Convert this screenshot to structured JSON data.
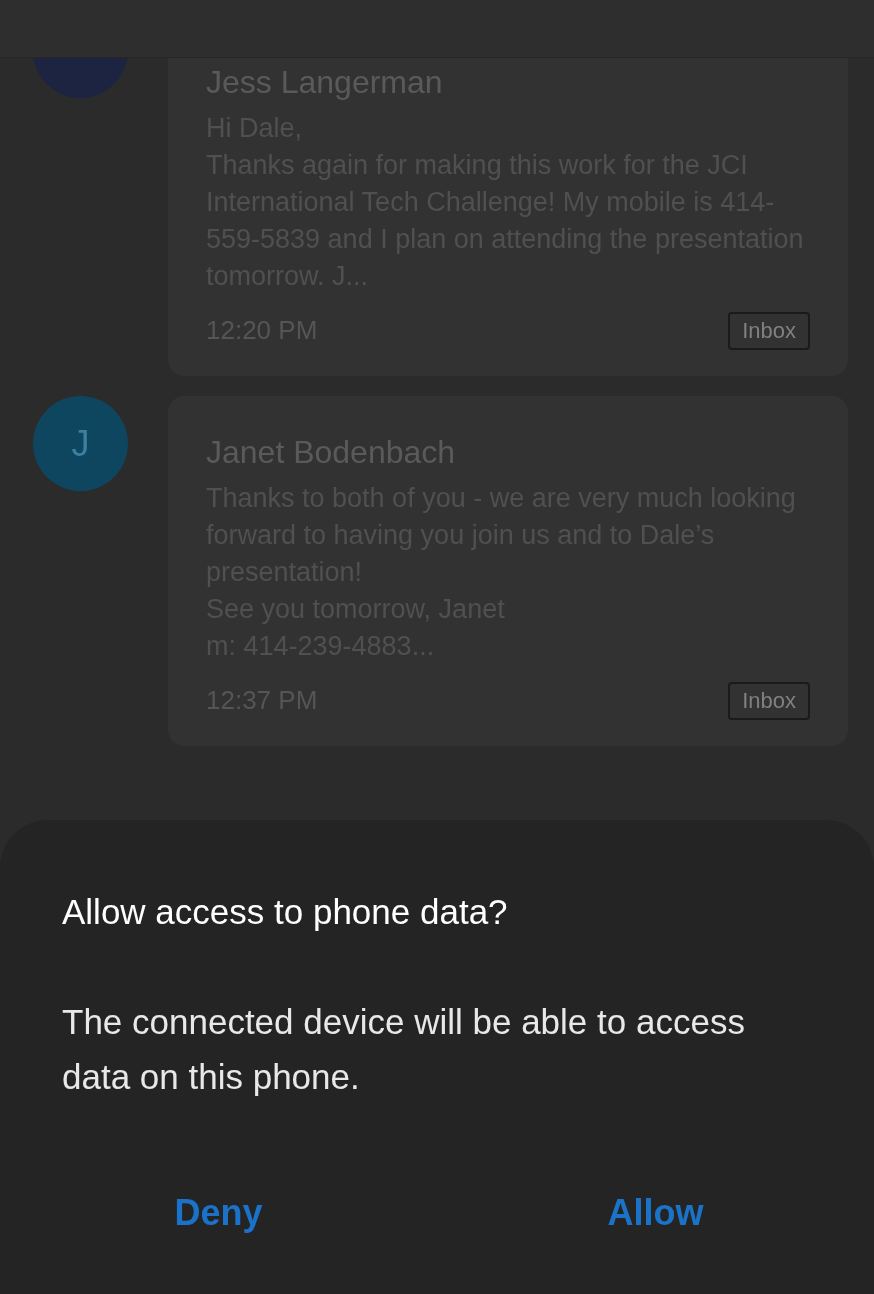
{
  "messages": [
    {
      "color": "#1c2442",
      "sender": "Jess Langerman",
      "preview": "Hi Dale,\nThanks again for making this work for the JCI International Tech Challenge! My mobile is 414-559-5839 and I plan on attending the presentation tomorrow. J...",
      "time": "12:20 PM",
      "folder": "Inbox",
      "cut": true
    },
    {
      "initial": "J",
      "color": "#0e4660",
      "sender": "Janet Bodenbach",
      "preview": "Thanks to both of you - we are very much looking forward to having you join us and to Dale’s presentation!\nSee you tomorrow, Janet\nm: 414-239-4883...",
      "time": "12:37 PM",
      "folder": "Inbox",
      "cut": false
    }
  ],
  "dialog": {
    "title": "Allow access to phone data?",
    "message": "The connected device will be able to access data on this phone.",
    "buttons": [
      "Deny",
      "Allow"
    ]
  }
}
